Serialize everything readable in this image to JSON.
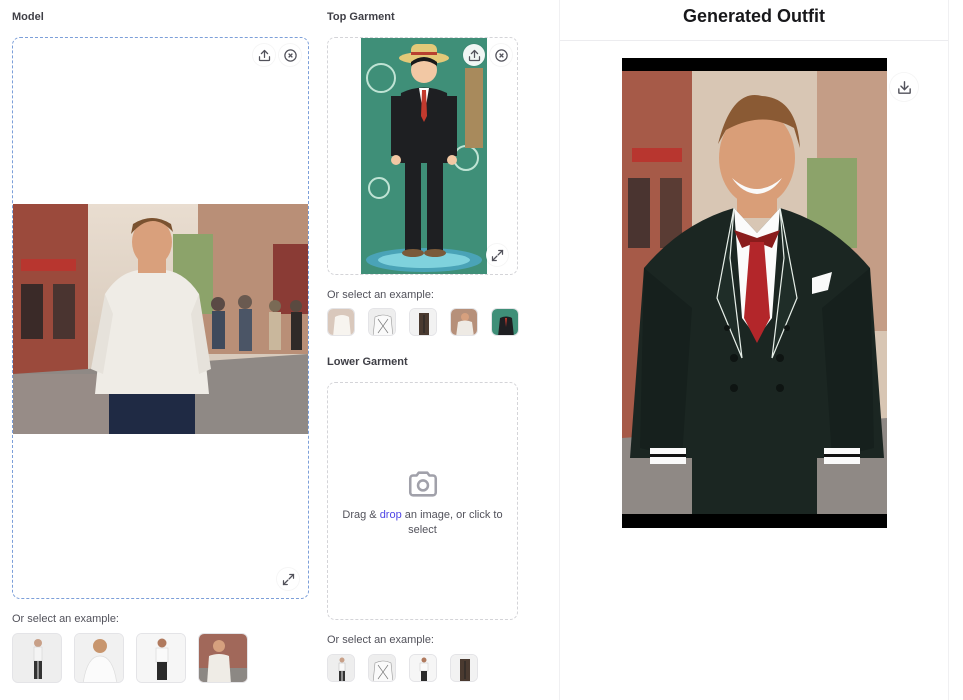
{
  "model": {
    "label": "Model",
    "examples_label": "Or select an example:"
  },
  "top_garment": {
    "label": "Top Garment",
    "examples_label": "Or select an example:"
  },
  "lower_garment": {
    "label": "Lower Garment",
    "drop_prefix": "Drag & ",
    "drop_link": "drop",
    "drop_suffix": " an image, or click to select",
    "examples_label": "Or select an example:"
  },
  "output": {
    "title": "Generated Outfit"
  },
  "icons": {
    "upload": "upload-icon",
    "clear": "close-circle-icon",
    "expand": "expand-icon",
    "download": "download-icon",
    "camera": "camera-icon"
  },
  "colors": {
    "accent_link": "#4f46e5",
    "active_border": "#7c9fd9",
    "dashed_border": "#d4d4d8"
  }
}
